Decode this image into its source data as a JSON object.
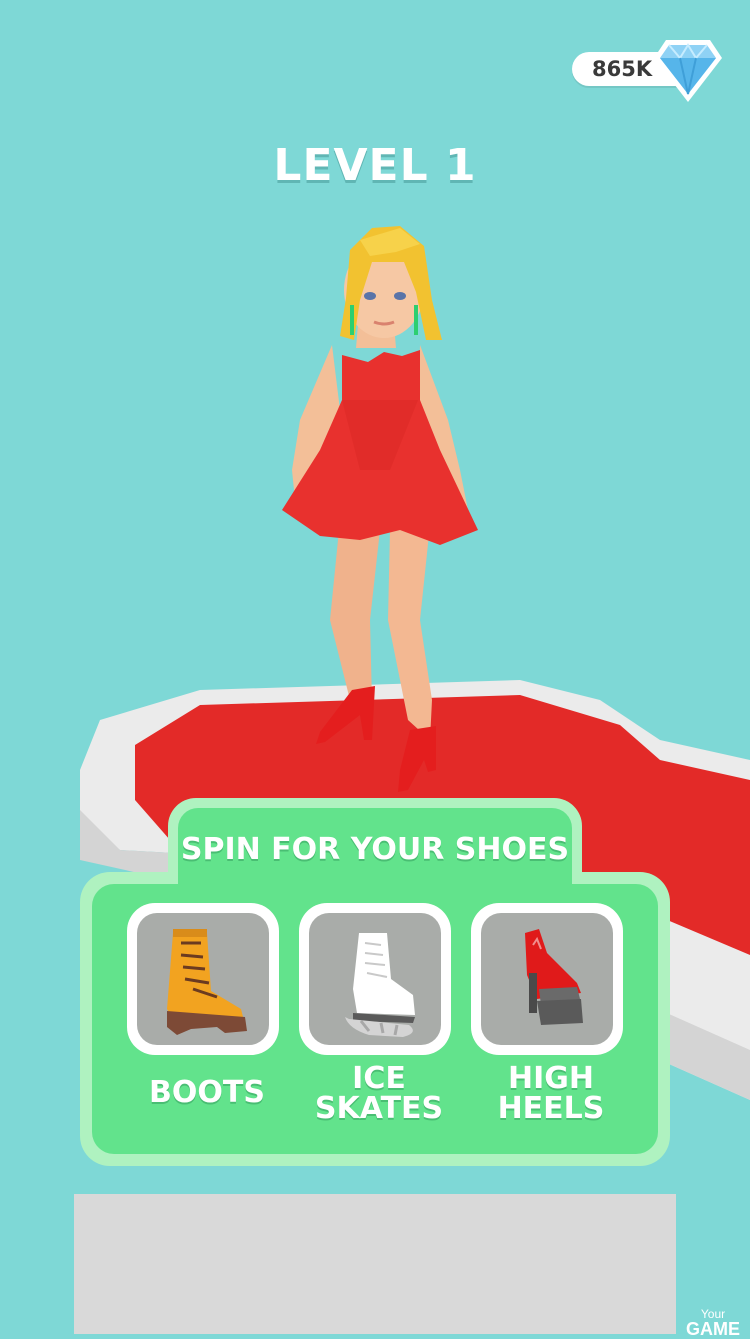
{
  "hud": {
    "gems": "865K",
    "gem_icon": "diamond-icon",
    "level_label": "LEVEL 1"
  },
  "shoe_panel": {
    "title": "SPIN FOR YOUR SHOES",
    "options": [
      {
        "label": "BOOTS",
        "icon": "boot-icon"
      },
      {
        "label": "ICE",
        "label2": "SKATES",
        "icon": "ice-skate-icon"
      },
      {
        "label": "HIGH",
        "label2": "HEELS",
        "icon": "high-heel-icon"
      }
    ]
  },
  "watermark": {
    "small": "Your",
    "big": "GAME"
  },
  "colors": {
    "background": "#7ed8d6",
    "panel": "#62e38c",
    "panel_border": "#aff2c0",
    "dress": "#e8312e",
    "platform": "#e32a28"
  }
}
